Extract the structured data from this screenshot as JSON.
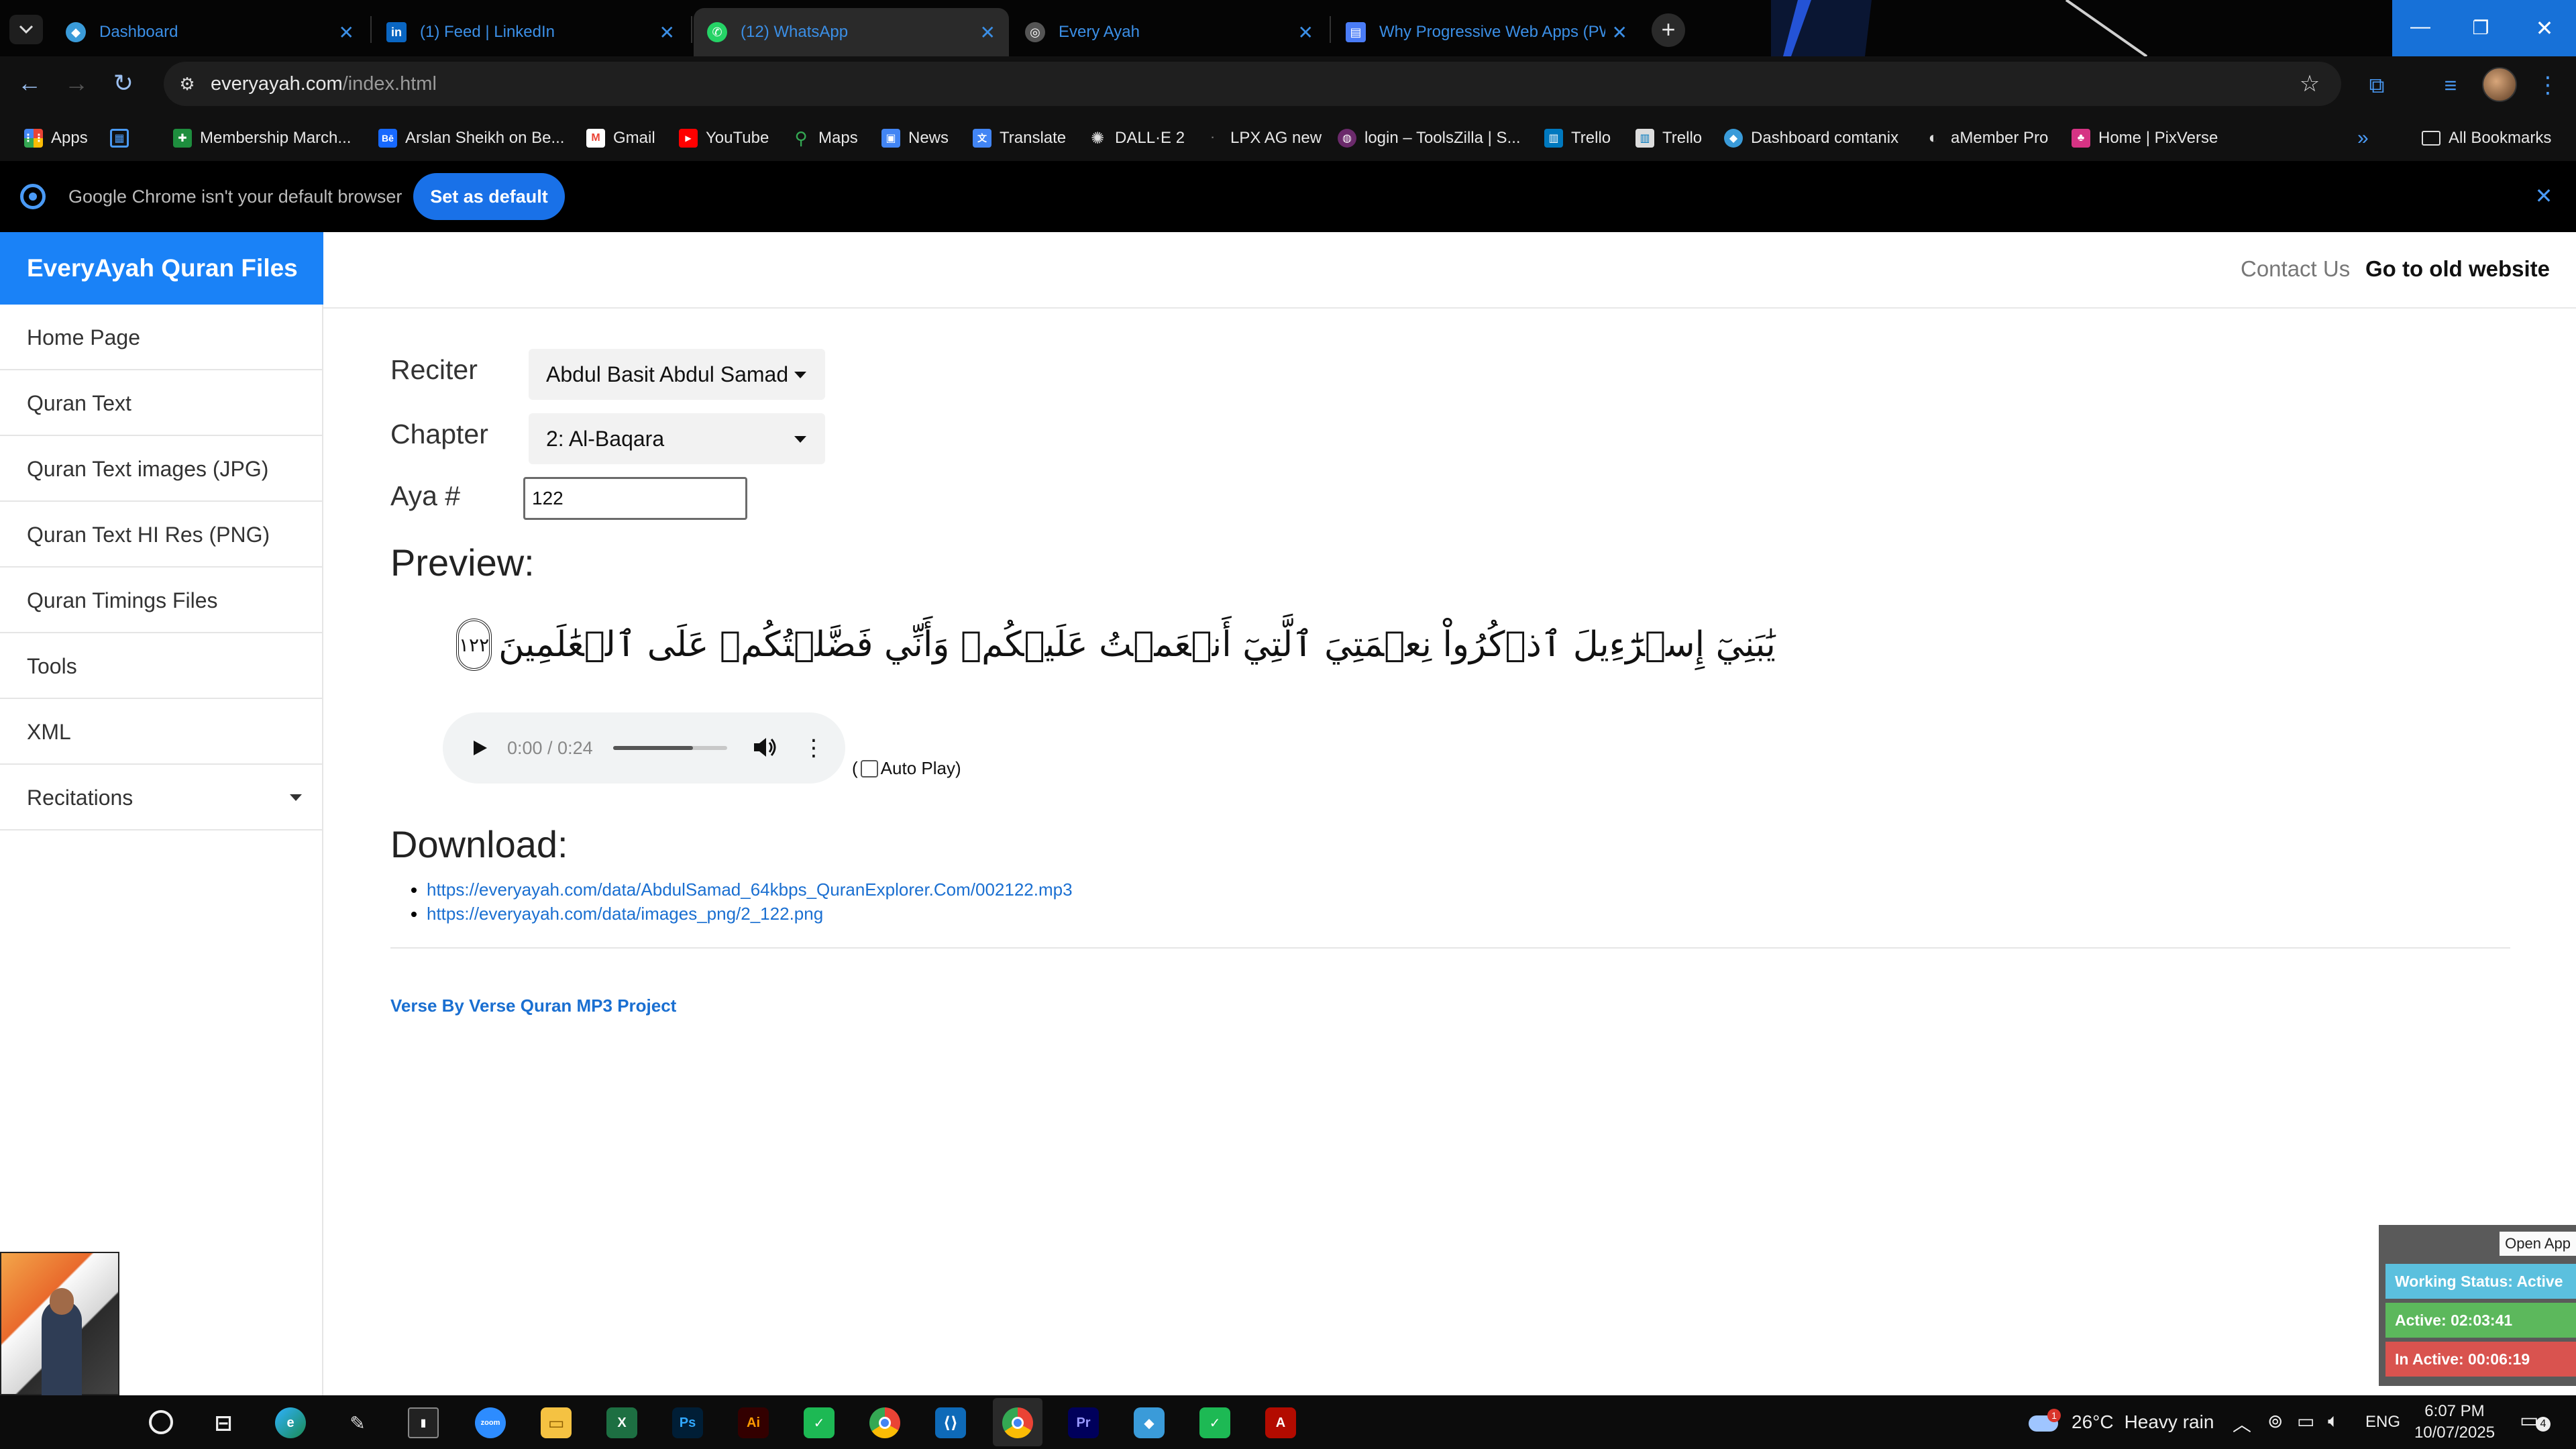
{
  "browser": {
    "tabs": [
      {
        "title": "Dashboard",
        "favicon": "dashboard-favicon"
      },
      {
        "title": "(1) Feed | LinkedIn",
        "favicon": "linkedin-favicon"
      },
      {
        "title": "(12) WhatsApp",
        "favicon": "whatsapp-favicon"
      },
      {
        "title": "Every Ayah",
        "favicon": "globe-favicon"
      },
      {
        "title": "Why Progressive Web Apps (PW",
        "favicon": "doc-favicon"
      }
    ],
    "url_host": "everyayah.com",
    "url_path": "/index.html",
    "bookmarks": [
      {
        "label": "Apps",
        "icon": "apps-grid-icon"
      },
      {
        "label": "",
        "icon": "grid-icon"
      },
      {
        "label": "Membership March...",
        "icon": "sheets-icon"
      },
      {
        "label": "Arslan Sheikh on Be...",
        "icon": "behance-icon"
      },
      {
        "label": "Gmail",
        "icon": "gmail-icon"
      },
      {
        "label": "YouTube",
        "icon": "youtube-icon"
      },
      {
        "label": "Maps",
        "icon": "maps-icon"
      },
      {
        "label": "News",
        "icon": "news-icon"
      },
      {
        "label": "Translate",
        "icon": "translate-icon"
      },
      {
        "label": "DALL·E 2",
        "icon": "openai-icon"
      },
      {
        "label": "LPX AG new",
        "icon": "lpx-icon"
      },
      {
        "label": "login – ToolsZilla | S...",
        "icon": "toolszilla-icon"
      },
      {
        "label": "Trello",
        "icon": "trello-icon"
      },
      {
        "label": "Trello",
        "icon": "trello-icon"
      },
      {
        "label": "Dashboard comtanix",
        "icon": "dashboard-icon"
      },
      {
        "label": "aMember Pro",
        "icon": "amember-icon"
      },
      {
        "label": "Home | PixVerse",
        "icon": "pixverse-icon"
      }
    ],
    "all_bookmarks": "All Bookmarks",
    "infobar_text": "Google Chrome isn't your default browser",
    "infobar_button": "Set as default"
  },
  "site": {
    "brand": "EveryAyah Quran Files",
    "nav": [
      "Home Page",
      "Quran Text",
      "Quran Text images (JPG)",
      "Quran Text HI Res (PNG)",
      "Quran Timings Files",
      "Tools",
      "XML",
      "Recitations"
    ],
    "top_links": {
      "contact": "Contact Us",
      "old_site": "Go to old website"
    },
    "form": {
      "reciter_label": "Reciter",
      "reciter_value": "Abdul Basit Abdul Samad",
      "chapter_label": "Chapter",
      "chapter_value": "2: Al-Baqara",
      "aya_label": "Aya #",
      "aya_value": "122"
    },
    "preview_heading": "Preview:",
    "verse_text": "يَٰبَنِيٓ إِسۡرَٰٓءِيلَ ٱذۡكُرُواْ نِعۡمَتِيَ ٱلَّتِيٓ أَنۡعَمۡتُ عَلَيۡكُمۡ وَأَنِّي فَضَّلۡتُكُمۡ عَلَى ٱلۡعَٰلَمِينَ",
    "verse_number": "١٢٢",
    "audio": {
      "time": "0:00 / 0:24",
      "volume_level": 0.7
    },
    "autoplay_prefix": "(",
    "autoplay_label": "Auto Play)",
    "download_heading": "Download:",
    "downloads": [
      "https://everyayah.com/data/AbdulSamad_64kbps_QuranExplorer.Com/002122.mp3",
      "https://everyayah.com/data/images_png/2_122.png"
    ],
    "footer_link": "Verse By Verse Quran MP3 Project"
  },
  "widget": {
    "open_app": "Open App",
    "status": "Working Status: Active",
    "active": "Active: 02:03:41",
    "inactive": "In Active: 00:06:19"
  },
  "taskbar": {
    "weather_temp": "26°C",
    "weather_desc": "Heavy rain",
    "weather_badge": "1",
    "lang": "ENG",
    "time": "6:07 PM",
    "date": "10/07/2025",
    "notif_count": "4"
  },
  "colors": {
    "brand_blue": "#1a82f7",
    "link_blue": "#1a6fd1",
    "tab_text_blue": "#3b8fe6",
    "status_teal": "#5bc0de",
    "active_green": "#5cb85c",
    "inactive_red": "#d9534f"
  }
}
